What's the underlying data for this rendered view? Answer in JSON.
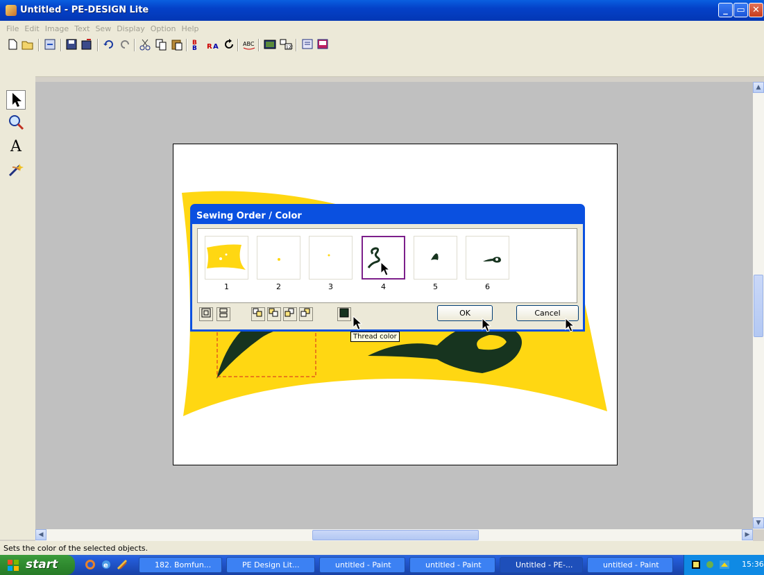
{
  "window": {
    "title": "Untitled - PE-DESIGN Lite",
    "buttons": [
      "_",
      "▭",
      "✕"
    ]
  },
  "menu": [
    "File",
    "Edit",
    "Image",
    "Text",
    "Sew",
    "Display",
    "Option",
    "Help"
  ],
  "toolbar_icons": [
    "new-icon",
    "open-icon",
    "import-icon",
    "save-icon",
    "save-as-icon",
    "undo-icon",
    "redo-icon",
    "cut-icon",
    "copy-icon",
    "paste-icon",
    "sew-order-icon",
    "reverse-icon",
    "rotate-icon",
    "text-abc-icon",
    "monitor-icon",
    "numbered-icon",
    "card-write-icon",
    "card-read-icon"
  ],
  "left_tools": [
    {
      "name": "select-arrow-icon",
      "glyph": "➤"
    },
    {
      "name": "zoom-icon",
      "glyph": "🔍"
    },
    {
      "name": "text-tool-icon",
      "glyph": "A"
    },
    {
      "name": "magic-wand-icon",
      "glyph": "✨"
    }
  ],
  "dialog": {
    "title": "Sewing Order / Color",
    "tiles": [
      {
        "number": "1"
      },
      {
        "number": "2"
      },
      {
        "number": "3"
      },
      {
        "number": "4"
      },
      {
        "number": "5"
      },
      {
        "number": "6"
      }
    ],
    "ok_label": "OK",
    "cancel_label": "Cancel"
  },
  "tooltip": "Thread color",
  "status": "Sets the color of the selected objects.",
  "colors": {
    "yellow": "#ffd712",
    "dark_green": "#17341f",
    "title_blue": "#0a50e0"
  },
  "taskbar": {
    "start_label": "start",
    "tasks": [
      {
        "label": "182. Bomfun...",
        "active": false
      },
      {
        "label": "PE Design Lit...",
        "active": false
      },
      {
        "label": "untitled - Paint",
        "active": false
      },
      {
        "label": "untitled - Paint",
        "active": false
      },
      {
        "label": "Untitled - PE-...",
        "active": true
      },
      {
        "label": "untitled - Paint",
        "active": false
      }
    ],
    "clock": "15:36"
  }
}
